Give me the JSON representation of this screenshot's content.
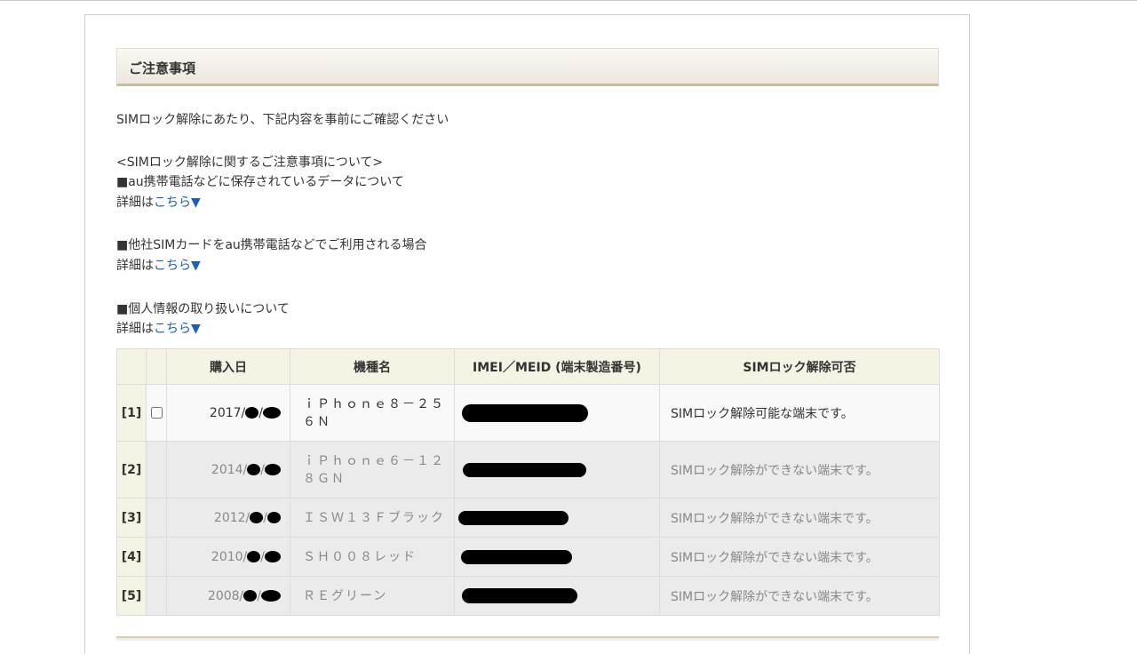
{
  "section_title": "ご注意事項",
  "intro": "SIMロック解除にあたり、下記内容を事前にご確認ください",
  "notes_heading": "<SIMロック解除に関するご注意事項について>",
  "notes": [
    {
      "title": "■au携帯電話などに保存されているデータについて",
      "prefix": "詳細は",
      "link": "こちら▼"
    },
    {
      "title": "■他社SIMカードをau携帯電話などでご利用される場合",
      "prefix": "詳細は",
      "link": "こちら▼"
    },
    {
      "title": "■個人情報の取り扱いについて",
      "prefix": "詳細は",
      "link": "こちら▼"
    }
  ],
  "table": {
    "headers": [
      "",
      "",
      "購入日",
      "機種名",
      "IMEI／MEID (端末製造番号)",
      "SIMロック解除可否"
    ],
    "rows": [
      {
        "num": "[1]",
        "checkbox": true,
        "date": "2017/",
        "model": "ｉＰｈｏｎｅ８－２５６Ｎ",
        "status": "SIMロック解除可能な端末です。"
      },
      {
        "num": "[2]",
        "checkbox": false,
        "date": "2014/",
        "model": "ｉＰｈｏｎｅ６－１２８ＧＮ",
        "status": "SIMロック解除ができない端末です。"
      },
      {
        "num": "[3]",
        "checkbox": false,
        "date": "2012/",
        "model": "ＩＳＷ１３Ｆブラック",
        "status": "SIMロック解除ができない端末です。"
      },
      {
        "num": "[4]",
        "checkbox": false,
        "date": "2010/",
        "model": "ＳＨ００８レッド",
        "status": "SIMロック解除ができない端末です。"
      },
      {
        "num": "[5]",
        "checkbox": false,
        "date": "2008/",
        "model": "ＲＥグリーン",
        "status": "SIMロック解除ができない端末です。"
      }
    ]
  }
}
